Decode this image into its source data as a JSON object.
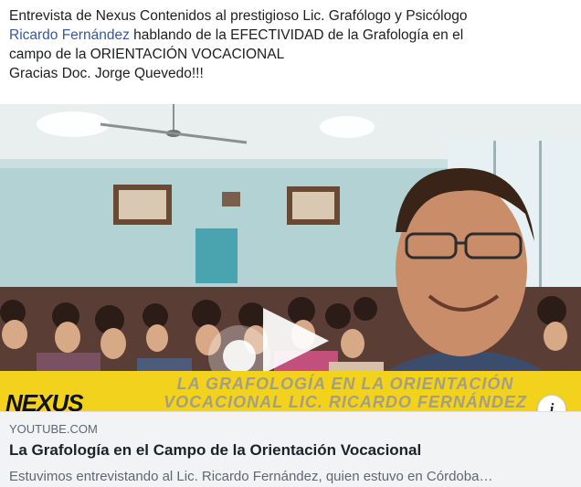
{
  "post": {
    "text_line1": "Entrevista de Nexus Contenidos al prestigioso Lic. Grafólogo y Psicólogo",
    "mention": "Ricardo Fernández",
    "text_line2_rest": " hablando de la EFECTIVIDAD de la Grafología en el",
    "text_line3": "campo de la ORIENTACIÓN VOCACIONAL",
    "text_line4": "Gracias Doc. Jorge Quevedo!!!"
  },
  "video": {
    "banner_line1": "LA GRAFOLOGÍA EN LA ORIENTACIÓN",
    "banner_line2": "VOCACIONAL LIC. RICARDO FERNÁNDEZ",
    "logo": "NEXUS",
    "info_label": "i"
  },
  "link_card": {
    "domain": "YOUTUBE.COM",
    "title": "La Grafología en el Campo de la Orientación Vocacional",
    "description": "Estuvimos entrevistando al Lic. Ricardo Fernández, quien estuvo en Córdoba…"
  },
  "colors": {
    "link": "#385898",
    "banner": "#f2d21c",
    "card_bg": "#f2f3f5"
  }
}
